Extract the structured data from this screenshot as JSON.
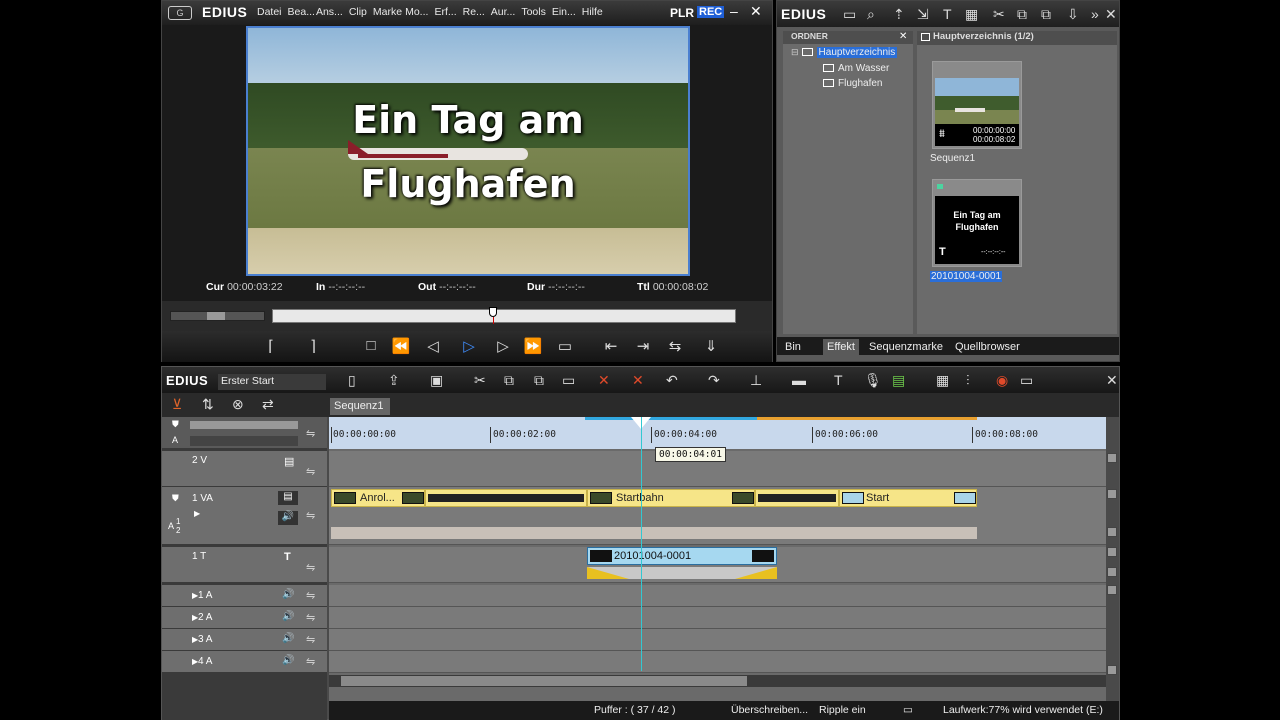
{
  "player": {
    "logo": "EDIUS",
    "menu": [
      "Datei",
      "Bea...",
      "Ans...",
      "Clip",
      "Marke",
      "Mo...",
      "Erf...",
      "Re...",
      "Aur...",
      "Tools",
      "Ein...",
      "Hilfe"
    ],
    "plr_label": "PLR",
    "rec_label": "REC",
    "video_title_line1": "Ein Tag am",
    "video_title_line2": "Flughafen",
    "timecodes": {
      "cur_label": "Cur",
      "cur": "00:00:03:22",
      "in_label": "In",
      "in": "--:--:--:--",
      "out_label": "Out",
      "out": "--:--:--:--",
      "dur_label": "Dur",
      "dur": "--:--:--:--",
      "ttl_label": "Ttl",
      "ttl": "00:00:08:02"
    }
  },
  "bin": {
    "logo": "EDIUS",
    "folder_header": "ORDNER",
    "folders": [
      "Hauptverzeichnis",
      "Am Wasser",
      "Flughafen"
    ],
    "clip_header": "Hauptverzeichnis (1/2)",
    "clips": [
      {
        "name": "Sequenz1",
        "tc1": "00:00:00:00",
        "tc2": "00:00:08:02"
      },
      {
        "name": "20101004-0001",
        "title_line1": "Ein Tag am",
        "title_line2": "Flughafen",
        "tc": "--:--:--:--"
      }
    ],
    "tabs": [
      "Bin",
      "Effekt",
      "Sequenzmarke",
      "Quellbrowser"
    ],
    "active_tab": "Effekt"
  },
  "timeline": {
    "logo": "EDIUS",
    "project_name": "Erster Start",
    "sequence_tab": "Sequenz1",
    "ruler_labels": [
      "00:00:00:00",
      "00:00:02:00",
      "00:00:04:00",
      "00:00:06:00",
      "00:00:08:00"
    ],
    "tooltip": "00:00:04:01",
    "tracks": {
      "v2": "2 V",
      "va1": "1 VA",
      "t1": "1 T",
      "a1": "1 A",
      "a2": "2 A",
      "a3": "3 A",
      "a4": "4 A",
      "a_label": "A",
      "a_nums": "1\n2"
    },
    "clips": {
      "anrol": "Anrol...",
      "startbahn": "Startbahn",
      "start": "Start",
      "title_clip": "20101004-0001"
    },
    "status": {
      "puffer": "Puffer : ( 37 / 42 )",
      "mode": "Überschreiben...",
      "ripple": "Ripple ein",
      "drive": "Laufwerk:77% wird verwendet (E:)"
    }
  },
  "colors": {
    "accent_blue": "#2a6ed8",
    "rec_bg": "#1f5fd6",
    "playhead": "#32c8d2",
    "clip_yellow": "#f6e588",
    "clip_blue": "#a6d8f0"
  }
}
